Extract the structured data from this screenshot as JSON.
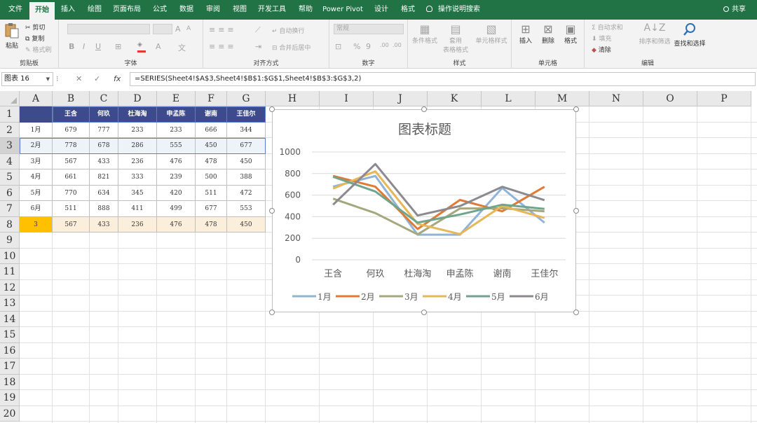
{
  "tabs": [
    {
      "label": "文件",
      "active": false
    },
    {
      "label": "开始",
      "active": true
    },
    {
      "label": "插入",
      "active": false
    },
    {
      "label": "绘图",
      "active": false
    },
    {
      "label": "页面布局",
      "active": false
    },
    {
      "label": "公式",
      "active": false
    },
    {
      "label": "数据",
      "active": false
    },
    {
      "label": "审阅",
      "active": false
    },
    {
      "label": "视图",
      "active": false
    },
    {
      "label": "开发工具",
      "active": false
    },
    {
      "label": "帮助",
      "active": false
    },
    {
      "label": "Power Pivot",
      "active": false
    },
    {
      "label": "设计",
      "active": false
    },
    {
      "label": "格式",
      "active": false
    }
  ],
  "tell_me": "操作说明搜索",
  "share": "共享",
  "ribbon": {
    "clipboard": {
      "paste": "粘贴",
      "cut": "剪切",
      "copy": "复制",
      "format_painter": "格式刷",
      "label": "剪贴板"
    },
    "font": {
      "bold": "B",
      "italic": "I",
      "underline": "U",
      "grow": "A",
      "shrink": "A",
      "color_a": "A",
      "wen": "文",
      "label": "字体"
    },
    "alignment": {
      "wrap": "自动换行",
      "merge": "合并后居中",
      "label": "对齐方式"
    },
    "number": {
      "format": "常规",
      "percent": "%",
      "comma": "9",
      "inc": ".00",
      "dec": ".00",
      "label": "数字"
    },
    "styles": {
      "cond": "条件格式",
      "table1": "套用",
      "table2": "表格格式",
      "cell": "单元格样式",
      "label": "样式"
    },
    "cells": {
      "insert": "插入",
      "delete": "删除",
      "format": "格式",
      "label": "单元格"
    },
    "editing": {
      "autosum": "自动求和",
      "fill": "填充",
      "clear": "清除",
      "sort": "排序和筛选",
      "find": "查找和选择",
      "label": "编辑"
    }
  },
  "name_box": "图表 16",
  "formula": "=SERIES(Sheet4!$A$3,Sheet4!$B$1:$G$1,Sheet4!$B$3:$G$3,2)",
  "formula_icons": {
    "cancel": "✕",
    "enter": "✓",
    "fx": "fx"
  },
  "columns": [
    "A",
    "B",
    "C",
    "D",
    "E",
    "F",
    "G",
    "H",
    "I",
    "J",
    "K",
    "L",
    "M",
    "N",
    "O",
    "P"
  ],
  "rows": [
    "1",
    "2",
    "3",
    "4",
    "5",
    "6",
    "7",
    "8",
    "9",
    "10",
    "11",
    "12",
    "13",
    "14",
    "15",
    "16",
    "17",
    "18",
    "19",
    "20"
  ],
  "table": {
    "headers": [
      "王含",
      "何玖",
      "杜海淘",
      "申孟陈",
      "谢南",
      "王佳尔"
    ],
    "rows": [
      {
        "label": "1月",
        "values": [
          "679",
          "777",
          "233",
          "233",
          "666",
          "344"
        ]
      },
      {
        "label": "2月",
        "values": [
          "778",
          "678",
          "286",
          "555",
          "450",
          "677"
        ]
      },
      {
        "label": "3月",
        "values": [
          "567",
          "433",
          "236",
          "476",
          "478",
          "450"
        ]
      },
      {
        "label": "4月",
        "values": [
          "661",
          "821",
          "333",
          "239",
          "500",
          "388"
        ]
      },
      {
        "label": "5月",
        "values": [
          "770",
          "634",
          "345",
          "420",
          "511",
          "472"
        ]
      },
      {
        "label": "6月",
        "values": [
          "511",
          "888",
          "411",
          "499",
          "677",
          "553"
        ]
      },
      {
        "label": "3",
        "values": [
          "567",
          "433",
          "236",
          "476",
          "478",
          "450"
        ]
      }
    ]
  },
  "chart_data": {
    "type": "line",
    "title": "图表标题",
    "categories": [
      "王含",
      "何玖",
      "杜海淘",
      "申孟陈",
      "谢南",
      "王佳尔"
    ],
    "ylim": [
      0,
      1000
    ],
    "yticks": [
      "0",
      "200",
      "400",
      "600",
      "800",
      "1000"
    ],
    "grid": true,
    "legend": "bottom",
    "series": [
      {
        "name": "1月",
        "color": "#8fb4d7",
        "values": [
          679,
          777,
          233,
          233,
          666,
          344
        ]
      },
      {
        "name": "2月",
        "color": "#e07a34",
        "values": [
          778,
          678,
          286,
          555,
          450,
          677
        ]
      },
      {
        "name": "3月",
        "color": "#a5a87c",
        "values": [
          567,
          433,
          236,
          476,
          478,
          450
        ]
      },
      {
        "name": "4月",
        "color": "#e8b656",
        "values": [
          661,
          821,
          333,
          239,
          500,
          388
        ]
      },
      {
        "name": "5月",
        "color": "#6ea58c",
        "values": [
          770,
          634,
          345,
          420,
          511,
          472
        ]
      },
      {
        "name": "6月",
        "color": "#8c8a90",
        "values": [
          511,
          888,
          411,
          499,
          677,
          553
        ]
      }
    ]
  }
}
